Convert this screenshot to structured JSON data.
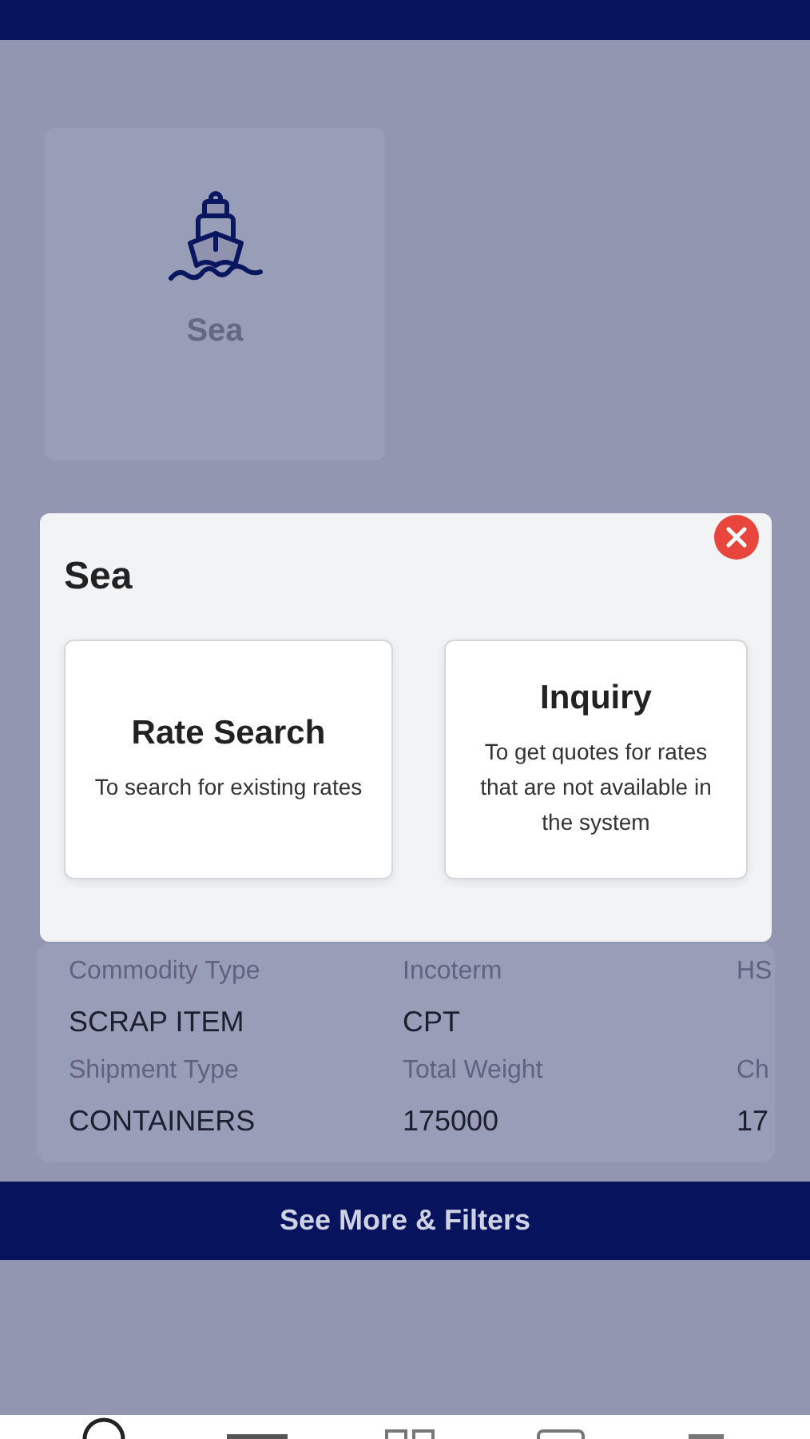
{
  "mode_cards": [
    {
      "label": "Sea"
    }
  ],
  "modal": {
    "title": "Sea",
    "options": [
      {
        "title": "Rate Search",
        "description": "To search for existing rates"
      },
      {
        "title": "Inquiry",
        "description": "To get quotes for rates that are not available in the system"
      }
    ]
  },
  "detail_rows": [
    [
      {
        "label": "Commodity Type",
        "value": "SCRAP ITEM"
      },
      {
        "label": "Incoterm",
        "value": "CPT"
      },
      {
        "label": "HS"
      }
    ],
    [
      {
        "label": "Shipment Type",
        "value": "CONTAINERS"
      },
      {
        "label": "Total Weight",
        "value": "175000"
      },
      {
        "label": "Ch",
        "value": "17"
      }
    ]
  ],
  "see_more_button": "See More & Filters"
}
